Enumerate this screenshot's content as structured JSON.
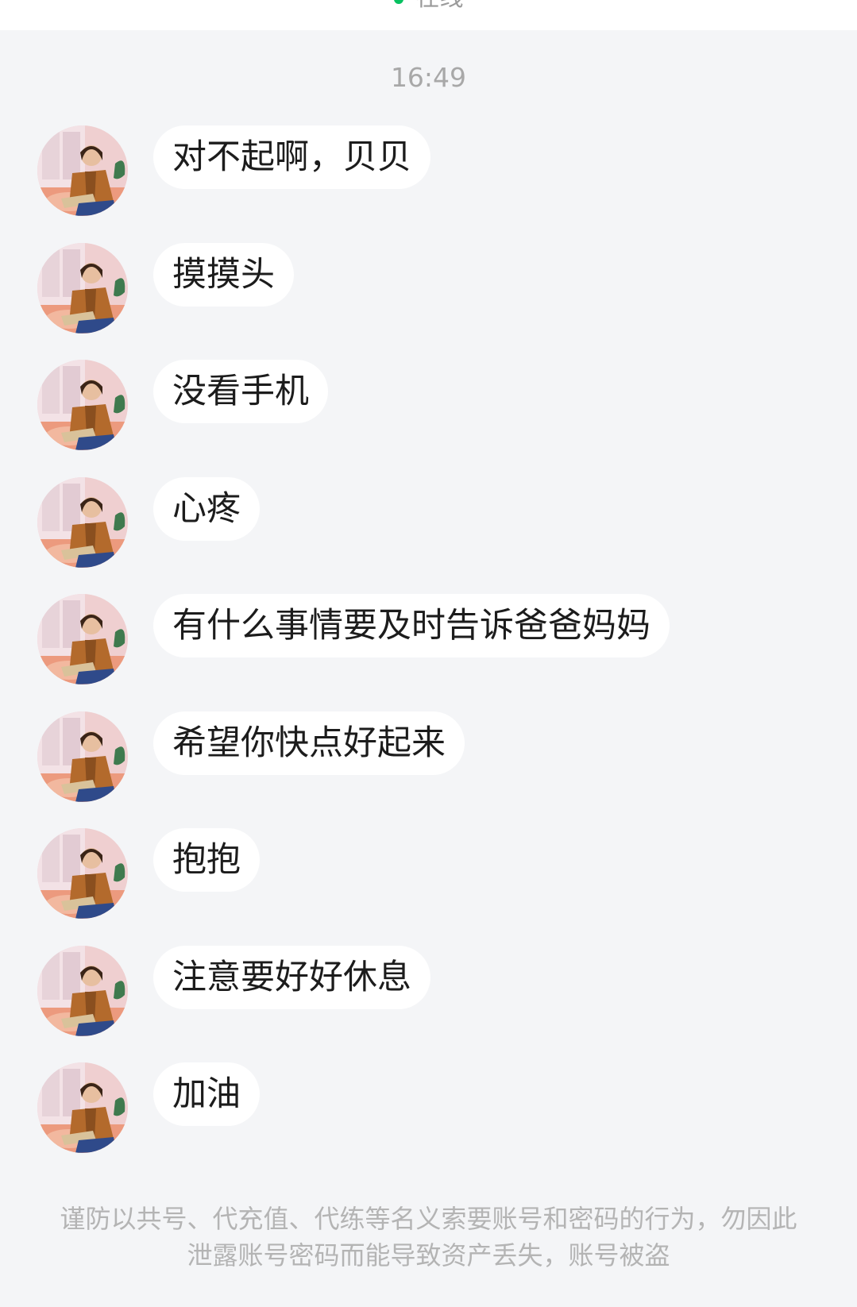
{
  "header": {
    "status_text": "在线"
  },
  "chat": {
    "timestamp": "16:49",
    "messages": [
      {
        "text": "对不起啊，贝贝"
      },
      {
        "text": "摸摸头"
      },
      {
        "text": "没看手机"
      },
      {
        "text": "心疼"
      },
      {
        "text": "有什么事情要及时告诉爸爸妈妈"
      },
      {
        "text": "希望你快点好起来"
      },
      {
        "text": "抱抱"
      },
      {
        "text": "注意要好好休息"
      },
      {
        "text": "加油"
      }
    ]
  },
  "footer": {
    "notice": "谨防以共号、代充值、代练等名义索要账号和密码的行为，勿因此泄露账号密码而能导致资产丢失，账号被盗"
  },
  "colors": {
    "background": "#f4f5f7",
    "bubble": "#ffffff",
    "online_dot": "#07c160"
  }
}
